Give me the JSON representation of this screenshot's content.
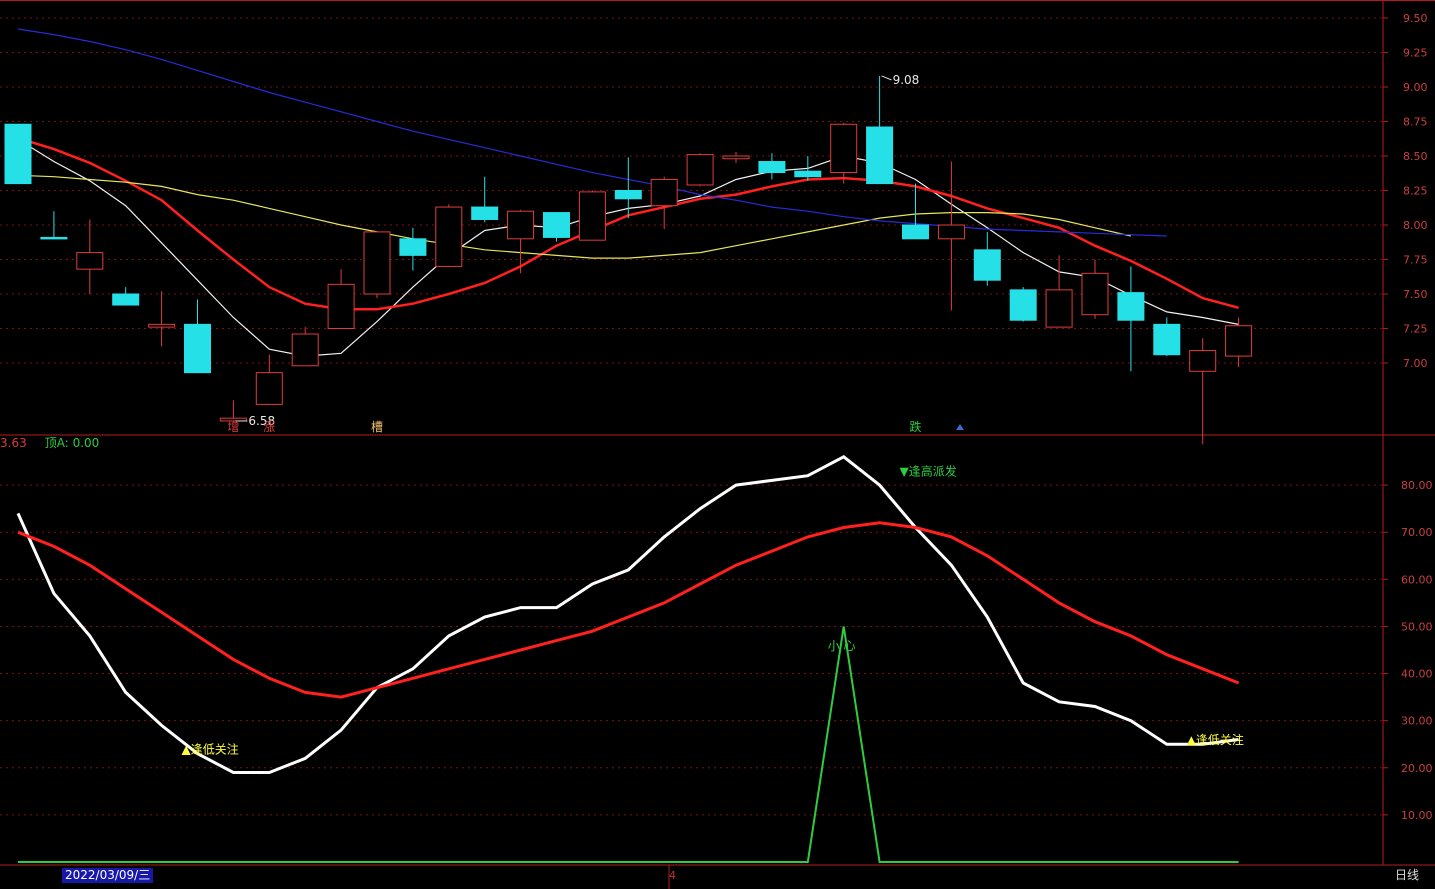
{
  "indicator_header": {
    "prefix": "3.63",
    "label": "顶A: 0.00"
  },
  "status_bar": {
    "date": "2022/03/09/三",
    "period": "日线",
    "page": "4"
  },
  "colors": {
    "up": "#e03c3c",
    "down": "#26e0e8",
    "ma5": "#f0f0f0",
    "ma10": "#ff2020",
    "ma20": "#e6e65a",
    "ma60": "#2a2ad6",
    "grid": "#7a1010",
    "axis": "#b31b1b",
    "axis_text": "#c84040",
    "signal_green": "#2ecc40",
    "signal_yellow": "#ffff40"
  },
  "chart_data": [
    {
      "type": "candlestick",
      "ylim": [
        6.5,
        9.5
      ],
      "yticks": [
        "9.50",
        "9.25",
        "9.00",
        "8.75",
        "8.50",
        "8.25",
        "8.00",
        "7.75",
        "7.50",
        "7.25",
        "7.00"
      ],
      "candles": [
        {
          "o": 8.73,
          "h": 8.73,
          "l": 8.3,
          "c": 8.3
        },
        {
          "o": 7.91,
          "h": 8.1,
          "l": 7.9,
          "c": 7.9
        },
        {
          "o": 7.68,
          "h": 8.04,
          "l": 7.5,
          "c": 7.8
        },
        {
          "o": 7.5,
          "h": 7.55,
          "l": 7.42,
          "c": 7.42
        },
        {
          "o": 7.26,
          "h": 7.52,
          "l": 7.12,
          "c": 7.28
        },
        {
          "o": 7.28,
          "h": 7.46,
          "l": 6.93,
          "c": 6.93
        },
        {
          "o": 6.58,
          "h": 6.73,
          "l": 6.58,
          "c": 6.6
        },
        {
          "o": 6.7,
          "h": 7.06,
          "l": 6.7,
          "c": 6.93
        },
        {
          "o": 6.98,
          "h": 7.26,
          "l": 6.98,
          "c": 7.21
        },
        {
          "o": 7.25,
          "h": 7.68,
          "l": 7.25,
          "c": 7.57
        },
        {
          "o": 7.5,
          "h": 7.95,
          "l": 7.47,
          "c": 7.95
        },
        {
          "o": 7.9,
          "h": 7.98,
          "l": 7.67,
          "c": 7.78
        },
        {
          "o": 7.7,
          "h": 8.15,
          "l": 7.7,
          "c": 8.13
        },
        {
          "o": 8.13,
          "h": 8.35,
          "l": 8.02,
          "c": 8.04
        },
        {
          "o": 7.9,
          "h": 8.11,
          "l": 7.65,
          "c": 8.1
        },
        {
          "o": 8.09,
          "h": 8.09,
          "l": 7.88,
          "c": 7.91
        },
        {
          "o": 7.89,
          "h": 8.25,
          "l": 7.89,
          "c": 8.24
        },
        {
          "o": 8.25,
          "h": 8.49,
          "l": 8.05,
          "c": 8.19
        },
        {
          "o": 8.14,
          "h": 8.35,
          "l": 7.97,
          "c": 8.33
        },
        {
          "o": 8.29,
          "h": 8.52,
          "l": 8.28,
          "c": 8.51
        },
        {
          "o": 8.48,
          "h": 8.53,
          "l": 8.45,
          "c": 8.5
        },
        {
          "o": 8.46,
          "h": 8.52,
          "l": 8.33,
          "c": 8.38
        },
        {
          "o": 8.39,
          "h": 8.5,
          "l": 8.32,
          "c": 8.35
        },
        {
          "o": 8.38,
          "h": 8.74,
          "l": 8.3,
          "c": 8.73
        },
        {
          "o": 8.71,
          "h": 9.08,
          "l": 8.3,
          "c": 8.3
        },
        {
          "o": 8.0,
          "h": 8.3,
          "l": 7.9,
          "c": 7.9
        },
        {
          "o": 7.9,
          "h": 8.46,
          "l": 7.38,
          "c": 8.0
        },
        {
          "o": 7.82,
          "h": 7.95,
          "l": 7.56,
          "c": 7.6
        },
        {
          "o": 7.53,
          "h": 7.55,
          "l": 7.3,
          "c": 7.31
        },
        {
          "o": 7.26,
          "h": 7.78,
          "l": 7.26,
          "c": 7.53
        },
        {
          "o": 7.35,
          "h": 7.75,
          "l": 7.32,
          "c": 7.65
        },
        {
          "o": 7.51,
          "h": 7.7,
          "l": 6.94,
          "c": 7.31
        },
        {
          "o": 7.28,
          "h": 7.33,
          "l": 7.05,
          "c": 7.06
        },
        {
          "o": 6.94,
          "h": 7.18,
          "l": 6.41,
          "c": 7.09
        },
        {
          "o": 7.05,
          "h": 7.33,
          "l": 6.97,
          "c": 7.27
        }
      ],
      "ma": [
        {
          "name": "MA5",
          "color": "#f0f0f0",
          "values": [
            8.62,
            8.46,
            8.32,
            8.14,
            7.87,
            7.6,
            7.33,
            7.1,
            7.05,
            7.07,
            7.3,
            7.55,
            7.78,
            7.96,
            8.0,
            7.98,
            8.06,
            8.12,
            8.15,
            8.21,
            8.33,
            8.39,
            8.41,
            8.5,
            8.45,
            8.33,
            8.15,
            7.98,
            7.8,
            7.66,
            7.62,
            7.49,
            7.37,
            7.33,
            7.28
          ]
        },
        {
          "name": "MA10",
          "color": "#ff2020",
          "values": [
            8.63,
            8.55,
            8.45,
            8.32,
            8.18,
            7.96,
            7.75,
            7.55,
            7.43,
            7.39,
            7.39,
            7.43,
            7.5,
            7.58,
            7.7,
            7.85,
            7.96,
            8.07,
            8.13,
            8.19,
            8.22,
            8.28,
            8.33,
            8.34,
            8.32,
            8.28,
            8.21,
            8.12,
            8.05,
            7.98,
            7.85,
            7.74,
            7.61,
            7.47,
            7.4
          ]
        },
        {
          "name": "MA20",
          "color": "#e6e65a",
          "values": [
            8.36,
            8.35,
            8.33,
            8.31,
            8.28,
            8.22,
            8.18,
            8.12,
            8.06,
            8.0,
            7.95,
            7.9,
            7.86,
            7.82,
            7.8,
            7.78,
            7.76,
            7.76,
            7.78,
            7.8,
            7.85,
            7.9,
            7.95,
            8.0,
            8.05,
            8.08,
            8.09,
            8.09,
            8.08,
            8.04,
            7.98,
            7.92
          ]
        },
        {
          "name": "MA60",
          "color": "#2a2ad6",
          "values": [
            9.42,
            9.38,
            9.33,
            9.27,
            9.2,
            9.12,
            9.04,
            8.96,
            8.89,
            8.82,
            8.75,
            8.68,
            8.62,
            8.56,
            8.5,
            8.44,
            8.38,
            8.33,
            8.28,
            8.22,
            8.18,
            8.13,
            8.1,
            8.06,
            8.03,
            8.01,
            7.99,
            7.97,
            7.96,
            7.95,
            7.94,
            7.93,
            7.92
          ]
        }
      ],
      "annotations": [
        {
          "label": "6.58",
          "index": 6,
          "value": 6.58
        },
        {
          "label": "9.08",
          "index": 24,
          "value": 9.08
        }
      ],
      "markers": [
        {
          "label": "增",
          "index": 6,
          "color": "#e03c3c"
        },
        {
          "label": "涨",
          "index": 7,
          "color": "#e03c3c"
        },
        {
          "label": "槽",
          "index": 10,
          "color": "#f0c070"
        },
        {
          "label": "跌",
          "index": 25,
          "color": "#2ecc40"
        }
      ]
    },
    {
      "type": "line",
      "ylim": [
        0,
        90
      ],
      "yticks": [
        "80.00",
        "70.00",
        "60.00",
        "50.00",
        "40.00",
        "30.00",
        "20.00",
        "10.00"
      ],
      "series": [
        {
          "color": "#ffffff",
          "values": [
            74,
            57,
            48,
            36,
            29,
            23,
            19,
            19,
            22,
            28,
            37,
            41,
            48,
            52,
            54,
            54,
            59,
            62,
            69,
            75,
            80,
            81,
            82,
            86,
            80,
            71,
            63,
            52,
            38,
            34,
            33,
            30,
            25,
            25,
            26
          ]
        },
        {
          "color": "#ff2020",
          "values": [
            70,
            67,
            63,
            58,
            53,
            48,
            43,
            39,
            36,
            35,
            37,
            39,
            41,
            43,
            45,
            47,
            49,
            52,
            55,
            59,
            63,
            66,
            69,
            71,
            72,
            71,
            69,
            65,
            60,
            55,
            51,
            48,
            44,
            41,
            38
          ]
        },
        {
          "color": "#2ecc40",
          "values": [
            0,
            0,
            0,
            0,
            0,
            0,
            0,
            0,
            0,
            0,
            0,
            0,
            0,
            0,
            0,
            0,
            0,
            0,
            0,
            0,
            0,
            0,
            0,
            50,
            0,
            0,
            0,
            0,
            0,
            0,
            0,
            0,
            0,
            0,
            0
          ]
        }
      ],
      "signals": [
        {
          "label": "▲逢低关注",
          "index": 5,
          "value": 23,
          "color": "#ffff40"
        },
        {
          "label": "▼逢高派发",
          "index": 25,
          "value": 82,
          "color": "#2ecc40"
        },
        {
          "label": "小 心",
          "index": 23,
          "value": 45,
          "color": "#2ecc40"
        },
        {
          "label": "▲逢低关注",
          "index": 33,
          "value": 25,
          "color": "#ffff40"
        }
      ]
    }
  ]
}
